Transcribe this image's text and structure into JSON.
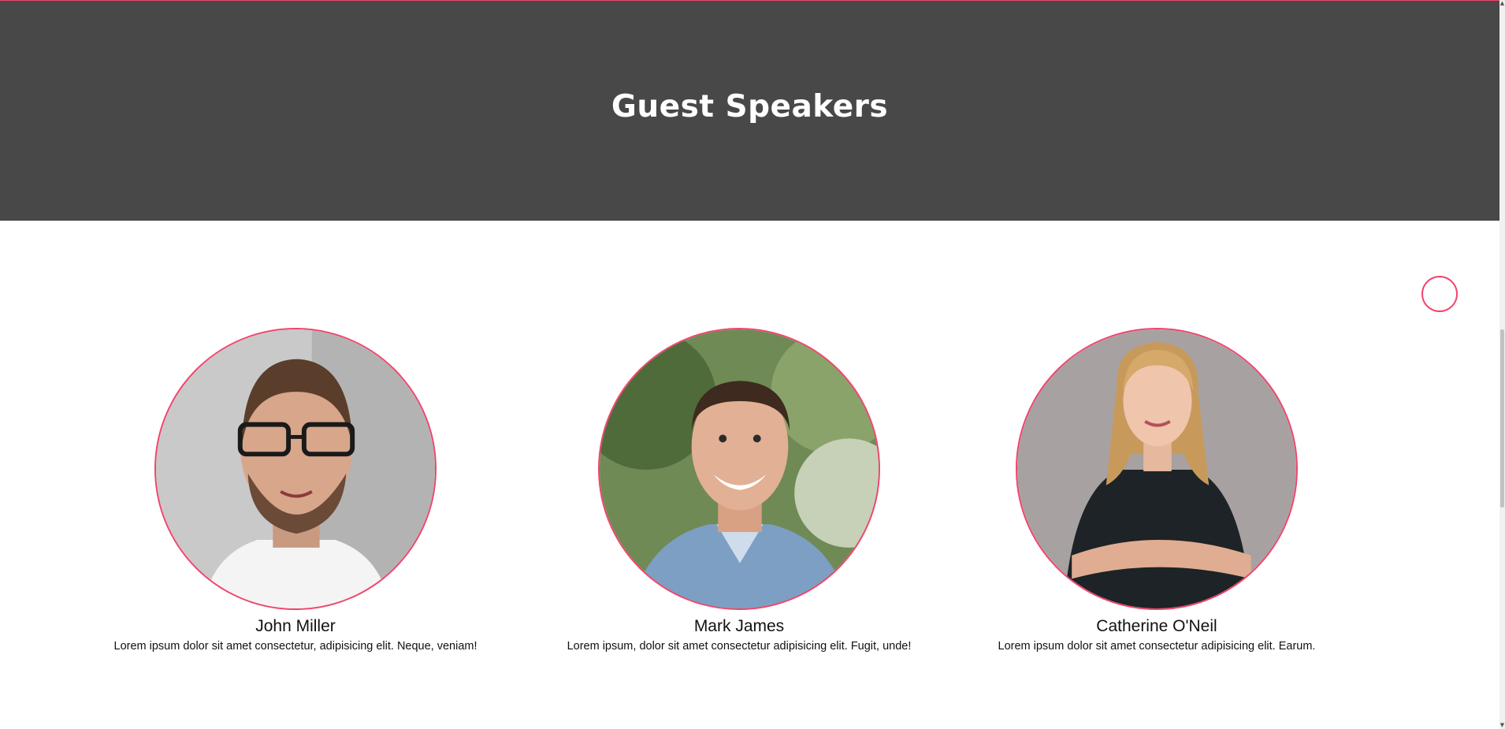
{
  "hero": {
    "title": "Guest Speakers"
  },
  "speakers": [
    {
      "name": "John Miller",
      "bio": "Lorem ipsum dolor sit amet consectetur, adipisicing elit. Neque, veniam!",
      "photo_icon": "man-with-glasses-photo"
    },
    {
      "name": "Mark James",
      "bio": "Lorem ipsum, dolor sit amet consectetur adipisicing elit. Fugit, unde!",
      "photo_icon": "smiling-man-blue-shirt-photo"
    },
    {
      "name": "Catherine O'Neil",
      "bio": "Lorem ipsum dolor sit amet consectetur adipisicing elit. Earum.",
      "photo_icon": "woman-arms-crossed-photo"
    }
  ],
  "colors": {
    "accent": "#f0446c",
    "hero_background": "#484848",
    "hero_text": "#ffffff",
    "body_text": "#111111"
  },
  "icons": {
    "scroll_button": "circle-outline-icon",
    "scroll_up": "scroll-up-arrow-icon",
    "scroll_down": "scroll-down-arrow-icon"
  }
}
